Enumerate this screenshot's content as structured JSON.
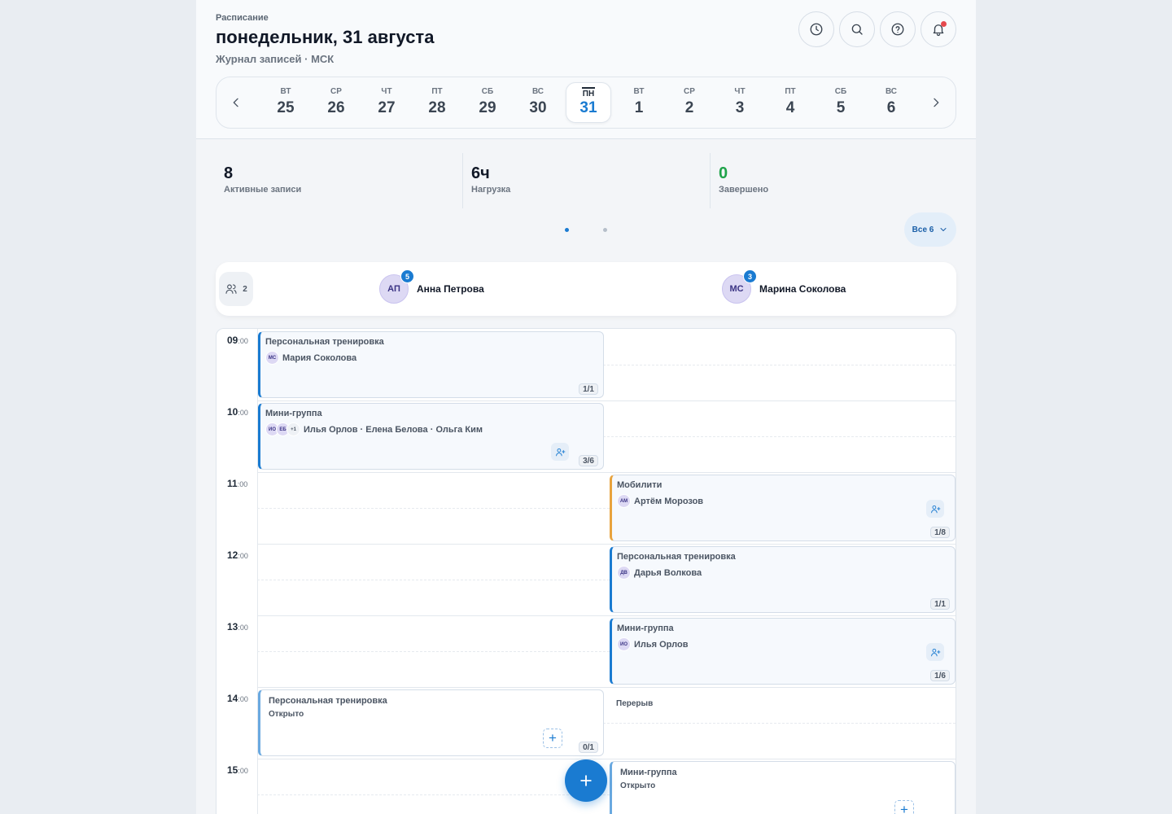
{
  "header": {
    "eyebrow": "Расписание",
    "title": "понедельник, 31 августа",
    "subtitle": "Журнал записей · МСК",
    "actions": [
      {
        "name": "clock-icon"
      },
      {
        "name": "search-icon"
      },
      {
        "name": "help-icon"
      },
      {
        "name": "bell-icon",
        "has_notification": true
      }
    ]
  },
  "days": [
    {
      "dow": "ВТ",
      "num": "25"
    },
    {
      "dow": "СР",
      "num": "26"
    },
    {
      "dow": "ЧТ",
      "num": "27"
    },
    {
      "dow": "ПТ",
      "num": "28"
    },
    {
      "dow": "СБ",
      "num": "29"
    },
    {
      "dow": "ВС",
      "num": "30"
    },
    {
      "dow": "ПН",
      "num": "31",
      "active": true
    },
    {
      "dow": "ВТ",
      "num": "1"
    },
    {
      "dow": "СР",
      "num": "2"
    },
    {
      "dow": "ЧТ",
      "num": "3"
    },
    {
      "dow": "ПТ",
      "num": "4"
    },
    {
      "dow": "СБ",
      "num": "5"
    },
    {
      "dow": "ВС",
      "num": "6"
    }
  ],
  "stats": [
    {
      "value": "8",
      "label": "Активные записи"
    },
    {
      "value": "6ч",
      "label": "Нагрузка"
    },
    {
      "value": "0",
      "label": "Завершено",
      "color": "#1fa34a"
    }
  ],
  "pager": {
    "pages": 2,
    "current": 1
  },
  "filter": {
    "label": "Все 6"
  },
  "staff_count": "2",
  "staff": [
    {
      "initials": "АП",
      "name": "Анна Петрова",
      "count": "5"
    },
    {
      "initials": "МС",
      "name": "Марина Соколова",
      "count": "3"
    }
  ],
  "hours": [
    "09",
    "10",
    "11",
    "12",
    "13",
    "14",
    "15"
  ],
  "hour_suffix": ":00",
  "events": [
    {
      "title": "Персональная тренировка",
      "avatars": [
        "МС"
      ],
      "people": "Мария Соколова",
      "capacity": "1/1"
    },
    {
      "title": "Мини-группа",
      "avatars": [
        "ИО",
        "ЕБ"
      ],
      "more": "+1",
      "people": "Илья Орлов · Елена Белова · Ольга Ким",
      "capacity": "3/6"
    },
    {
      "title": "Мобилити",
      "avatars": [
        "АМ"
      ],
      "people": "Артём Морозов",
      "capacity": "1/8"
    },
    {
      "title": "Персональная тренировка",
      "avatars": [
        "ДВ"
      ],
      "people": "Дарья Волкова",
      "capacity": "1/1"
    },
    {
      "title": "Мини-группа",
      "avatars": [
        "ИО"
      ],
      "people": "Илья Орлов",
      "capacity": "1/6"
    },
    {
      "title": "Персональная тренировка",
      "status": "Открыто",
      "capacity": "0/1"
    },
    {
      "title": "Мини-группа",
      "status": "Открыто"
    }
  ],
  "break_label": "Перерыв",
  "colors": {
    "accent": "#1a7bd1",
    "orange": "#e8a33d",
    "success": "#1fa34a",
    "notification": "#e5484d"
  }
}
